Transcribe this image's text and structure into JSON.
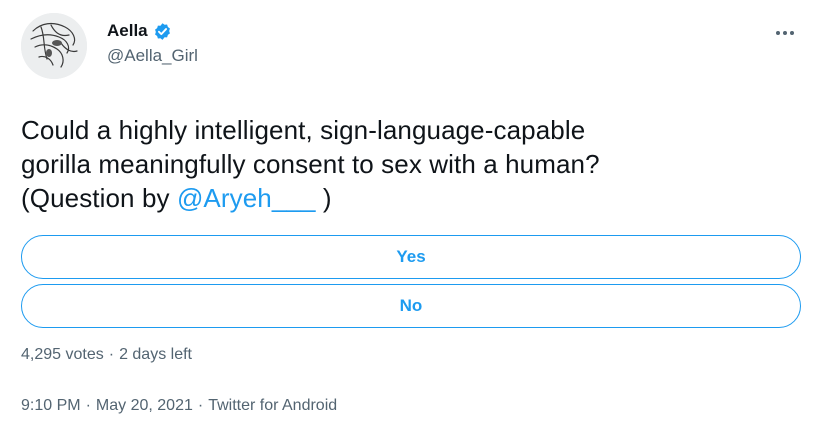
{
  "author": {
    "display_name": "Aella",
    "handle": "@Aella_Girl",
    "verified": true,
    "avatar_icon": "avatar-sketch-image",
    "verified_icon": "verified-badge-icon"
  },
  "menu": {
    "more_icon": "more-horizontal-icon"
  },
  "tweet": {
    "text_line1": "Could a highly intelligent, sign-language-capable",
    "text_line2": "gorilla meaningfully consent to sex with a human?",
    "text_line3_prefix": "(Question by ",
    "mention": "@Aryeh___",
    "text_line3_suffix": " )"
  },
  "poll": {
    "options": [
      {
        "label": "Yes"
      },
      {
        "label": "No"
      }
    ],
    "votes": "4,295 votes",
    "separator": "·",
    "time_left": "2 days left"
  },
  "meta": {
    "time": "9:10 PM",
    "date": "May 20, 2021",
    "source": "Twitter for Android",
    "separator": "·"
  },
  "colors": {
    "accent": "#1d9bf0",
    "text_primary": "#0f1419",
    "text_secondary": "#536471"
  }
}
